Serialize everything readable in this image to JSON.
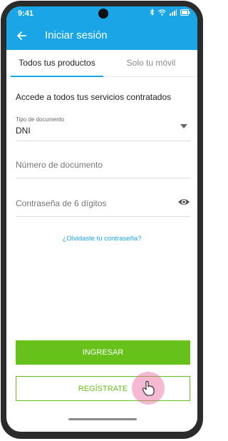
{
  "status": {
    "time": "9:41"
  },
  "appbar": {
    "title": "Iniciar sesión"
  },
  "tabs": [
    {
      "label": "Todos tus productos",
      "active": true
    },
    {
      "label": "Solo tu móvil",
      "active": false
    }
  ],
  "form": {
    "heading": "Accede a todos tus servicios contratados",
    "doc_type": {
      "label": "Tipo de documento",
      "value": "DNI"
    },
    "doc_number": {
      "placeholder": "Número de documento"
    },
    "password": {
      "placeholder": "Contraseña de 6 dígitos"
    },
    "forgot_link": "¿Olvidaste tu contraseña?"
  },
  "buttons": {
    "login": "INGRESAR",
    "register": "REGÍSTRATE"
  },
  "colors": {
    "brand_blue": "#1aa6e6",
    "brand_green": "#66c21a"
  }
}
